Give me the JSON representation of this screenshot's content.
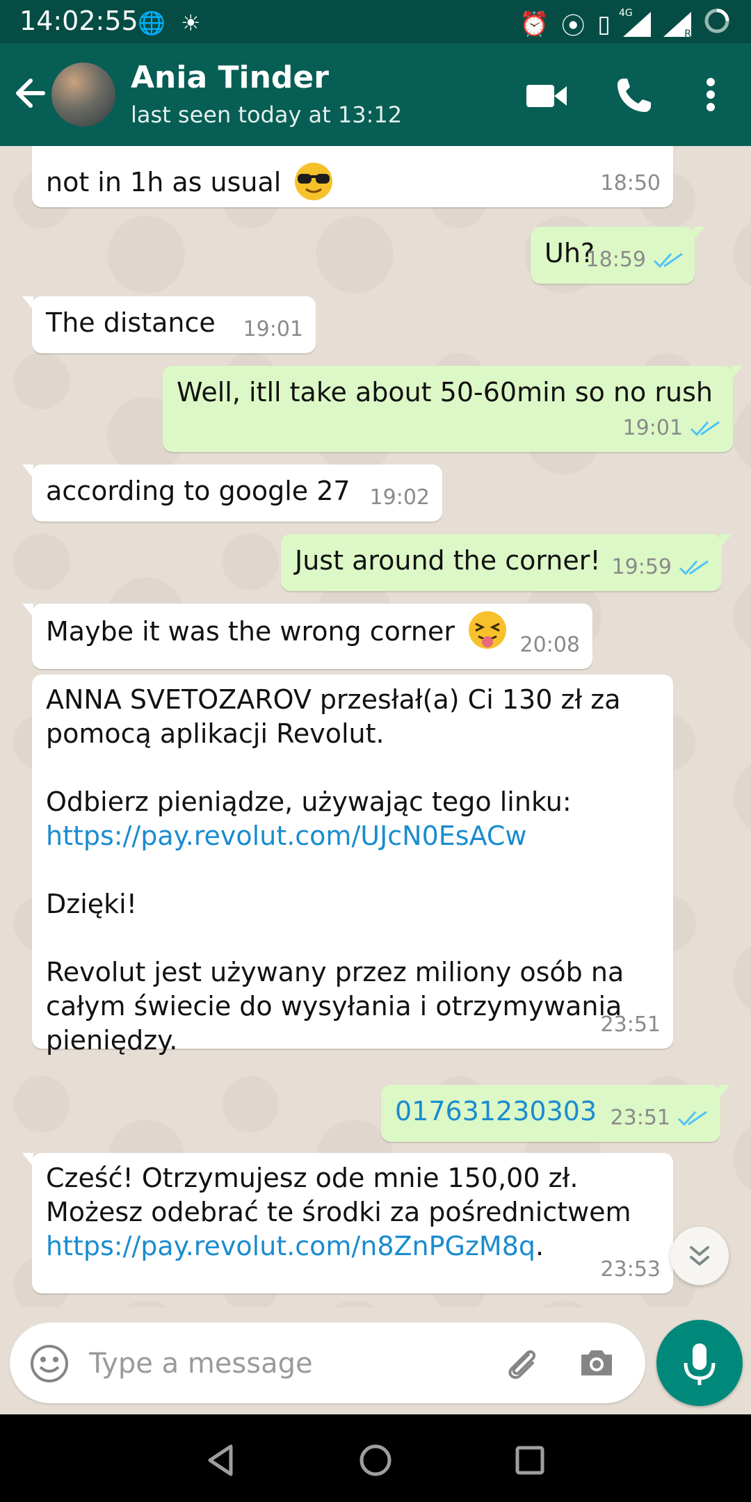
{
  "status_bar": {
    "time": "14:02:55",
    "network_label": "4G",
    "roaming_label": "R"
  },
  "header": {
    "contact_name": "Ania Tinder",
    "last_seen": "last seen today at 13:12",
    "icons": [
      "back-arrow-icon",
      "video-call-icon",
      "phone-icon",
      "more-vert-icon"
    ]
  },
  "messages": [
    {
      "dir": "in",
      "text": "not in 1h as usual",
      "emoji": "sunglasses",
      "time": "18:50"
    },
    {
      "dir": "out",
      "text": "Uh?",
      "time": "18:59"
    },
    {
      "dir": "in",
      "text": "The distance",
      "time": "19:01"
    },
    {
      "dir": "out",
      "text": "Well, itll take about 50-60min so no rush",
      "time": "19:01"
    },
    {
      "dir": "in",
      "text": "according to google 27",
      "time": "19:02"
    },
    {
      "dir": "out",
      "text": "Just around the corner!",
      "time": "19:59"
    },
    {
      "dir": "in",
      "text": "Maybe it was the wrong corner",
      "emoji": "tongue-wink",
      "time": "20:08"
    },
    {
      "dir": "in",
      "line1": "ANNA SVETOZAROV przesłał(a) Ci 130 zł za",
      "line2": "pomocą aplikacji Revolut.",
      "line3": "Odbierz pieniądze, używając tego linku:",
      "link": "https://pay.revolut.com/UJcN0EsACw",
      "line4": "Dzięki!",
      "line5": "Revolut jest używany przez miliony osób na",
      "line6": "całym świecie do wysyłania i otrzymywania",
      "line7": "pieniędzy.",
      "time": "23:51"
    },
    {
      "dir": "out",
      "text": "017631230303",
      "time": "23:51"
    },
    {
      "dir": "in",
      "line1": "Cześć! Otrzymujesz ode mnie 150,00 zł.",
      "line2": "Możesz odebrać te środki za pośrednictwem",
      "link": "https://pay.revolut.com/n8ZnPGzM8q",
      "link_suffix": ".",
      "time": "23:53"
    }
  ],
  "input": {
    "placeholder": "Type a message"
  },
  "colors": {
    "header": "#075e54",
    "status_bar": "#054d44",
    "outgoing_bubble": "#dcf8c6",
    "incoming_bubble": "#ffffff",
    "read_ticks": "#4fc3f7",
    "link": "#1a8ccf",
    "mic_button": "#00897b"
  }
}
